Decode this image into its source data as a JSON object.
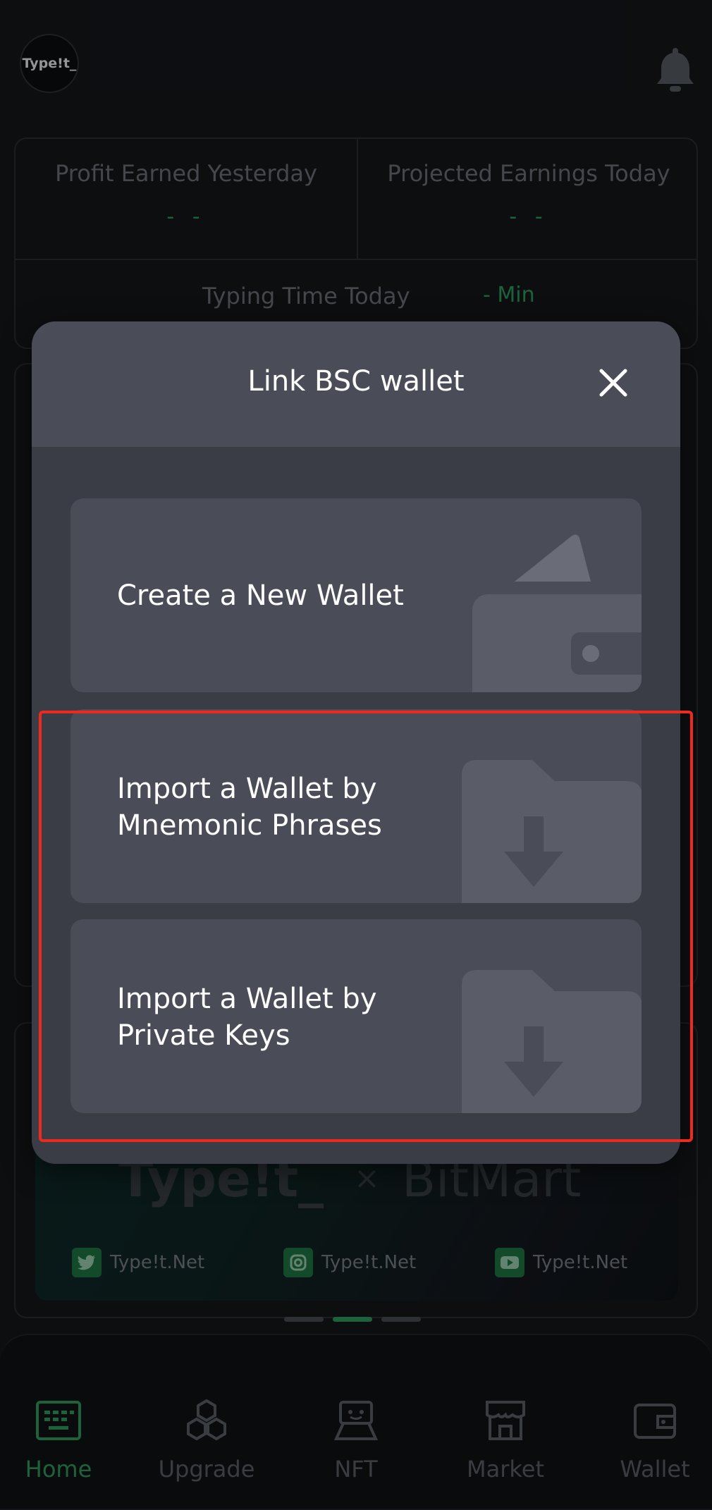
{
  "app": {
    "logo_text": "Type!t_",
    "stats": {
      "profit_yesterday_label": "Profit Earned Yesterday",
      "profit_yesterday_value": "- -",
      "projected_today_label": "Projected Earnings Today",
      "projected_today_value": "- -",
      "typing_time_label": "Typing Time Today",
      "typing_time_value": "- Min"
    },
    "banner": {
      "brand": "Type!t_",
      "cross": "×",
      "partner": "BitMart",
      "socials": [
        {
          "icon": "twitter-icon",
          "label": "Type!t.Net"
        },
        {
          "icon": "instagram-icon",
          "label": "Type!t.Net"
        },
        {
          "icon": "youtube-icon",
          "label": "Type!t.Net"
        }
      ]
    },
    "tabs": [
      {
        "label": "Home",
        "icon": "keyboard-icon",
        "active": true
      },
      {
        "label": "Upgrade",
        "icon": "hexagons-icon",
        "active": false
      },
      {
        "label": "NFT",
        "icon": "robot-icon",
        "active": false
      },
      {
        "label": "Market",
        "icon": "store-icon",
        "active": false
      },
      {
        "label": "Wallet",
        "icon": "wallet-icon",
        "active": false
      }
    ]
  },
  "modal": {
    "title": "Link BSC wallet",
    "options": [
      {
        "label_line1": "Create a New Wallet",
        "label_line2": "",
        "icon": "wallet-icon"
      },
      {
        "label_line1": "Import a Wallet by",
        "label_line2": "Mnemonic Phrases",
        "icon": "folder-download-icon"
      },
      {
        "label_line1": "Import a Wallet by",
        "label_line2": "Private Keys",
        "icon": "folder-download-icon"
      }
    ]
  },
  "colors": {
    "accent_green": "#2ea162",
    "highlight_red": "#ee2a1f",
    "modal_bg": "#3a3d46",
    "card_bg": "#4a4d57"
  }
}
